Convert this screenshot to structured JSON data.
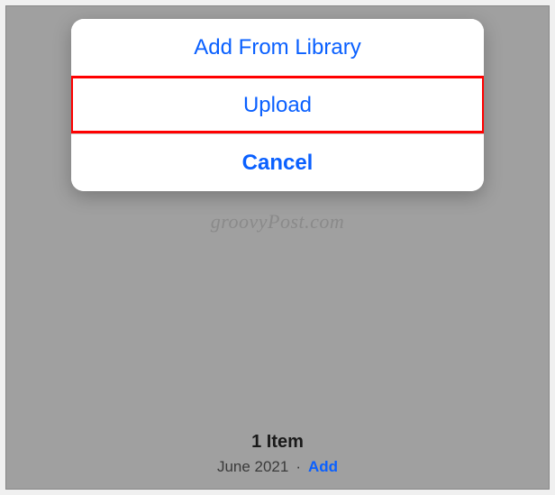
{
  "actionSheet": {
    "addFromLibrary": "Add From Library",
    "upload": "Upload",
    "cancel": "Cancel"
  },
  "watermark": "groovyPost.com",
  "footer": {
    "itemCount": "1 Item",
    "date": "June 2021",
    "separator": "·",
    "addLabel": "Add"
  }
}
